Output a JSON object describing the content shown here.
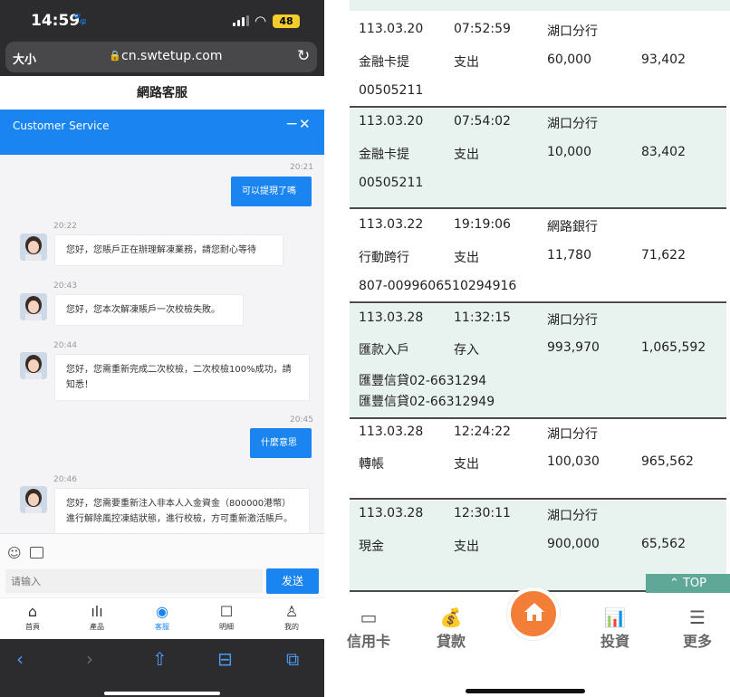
{
  "left": {
    "status": {
      "time": "14:59",
      "battery": "48"
    },
    "browser": {
      "size_label": "大小",
      "url": "cn.swtetup.com"
    },
    "page_title": "網路客服",
    "cs": {
      "title": "Customer Service",
      "minimize": "−",
      "close": "✕"
    },
    "chat": [
      {
        "time": "20:21",
        "from": "me",
        "text": "可以提現了嗎"
      },
      {
        "time": "20:22",
        "from": "agent",
        "text": "您好，您賬戶正在辦理解凍業務，請您耐心等待"
      },
      {
        "time": "20:43",
        "from": "agent",
        "text": "您好，您本次解凍賬戶一次校檢失敗。"
      },
      {
        "time": "20:44",
        "from": "agent",
        "text": "您好，您需重新完成二次校檢，二次校檢100%成功，請知悉！"
      },
      {
        "time": "20:45",
        "from": "me",
        "text": "什麼意思"
      },
      {
        "time": "20:46",
        "from": "agent",
        "text": "您好，您需要重新注入非本人入金資金（800000港幣）進行解除風控凍結狀態，進行校檢，方可重新激活賬戶。"
      }
    ],
    "input": {
      "placeholder": "请输入",
      "send_label": "发送"
    },
    "tabs": [
      {
        "label": "首頁",
        "icon": "home-icon"
      },
      {
        "label": "產品",
        "icon": "chart-icon"
      },
      {
        "label": "客服",
        "icon": "headset-icon"
      },
      {
        "label": "明細",
        "icon": "edit-icon"
      },
      {
        "label": "我的",
        "icon": "user-icon"
      }
    ],
    "accent": "#1a84f0"
  },
  "right": {
    "transactions": [
      {
        "date": "113.03.20",
        "time": "07:52:59",
        "branch": "湖口分行",
        "desc": "金融卡提",
        "type": "支出",
        "amount": "60,000",
        "balance": "93,402",
        "memo": [
          "00505211"
        ]
      },
      {
        "date": "113.03.20",
        "time": "07:54:02",
        "branch": "湖口分行",
        "desc": "金融卡提",
        "type": "支出",
        "amount": "10,000",
        "balance": "83,402",
        "memo": [
          "00505211"
        ]
      },
      {
        "date": "113.03.22",
        "time": "19:19:06",
        "branch": "網路銀行",
        "desc": "行動跨行",
        "type": "支出",
        "amount": "11,780",
        "balance": "71,622",
        "memo": [
          "807-0099606510294916"
        ]
      },
      {
        "date": "113.03.28",
        "time": "11:32:15",
        "branch": "湖口分行",
        "desc": "匯款入戶",
        "type": "存入",
        "amount": "993,970",
        "balance": "1,065,592",
        "memo": [
          "匯豐信貸02-6631294",
          "匯豐信貸02-66312949"
        ]
      },
      {
        "date": "113.03.28",
        "time": "12:24:22",
        "branch": "湖口分行",
        "desc": "轉帳",
        "type": "支出",
        "amount": "100,030",
        "balance": "965,562",
        "memo": []
      },
      {
        "date": "113.03.28",
        "time": "12:30:11",
        "branch": "湖口分行",
        "desc": "現金",
        "type": "支出",
        "amount": "900,000",
        "balance": "65,562",
        "memo": []
      }
    ],
    "top_label": "⌃ TOP",
    "nav": [
      {
        "label": "信用卡",
        "icon": "credit-card-icon"
      },
      {
        "label": "貸款",
        "icon": "money-bag-icon"
      },
      {
        "label": "投資",
        "icon": "bar-chart-icon"
      },
      {
        "label": "更多",
        "icon": "menu-icon"
      }
    ],
    "home_color": "#f37e37",
    "row_tint": "#e8f3ef"
  }
}
